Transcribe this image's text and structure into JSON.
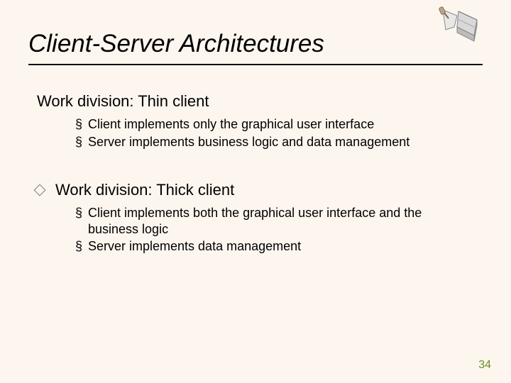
{
  "title": "Client-Server Architectures",
  "sections": [
    {
      "heading": "Work division: Thin client",
      "bullets": [
        "Client implements only the graphical user interface",
        "Server implements business logic and data management"
      ]
    },
    {
      "heading": "Work division: Thick client",
      "bullets": [
        "Client implements both the graphical user interface and the business logic",
        "Server implements data management"
      ]
    }
  ],
  "page_number": "34"
}
